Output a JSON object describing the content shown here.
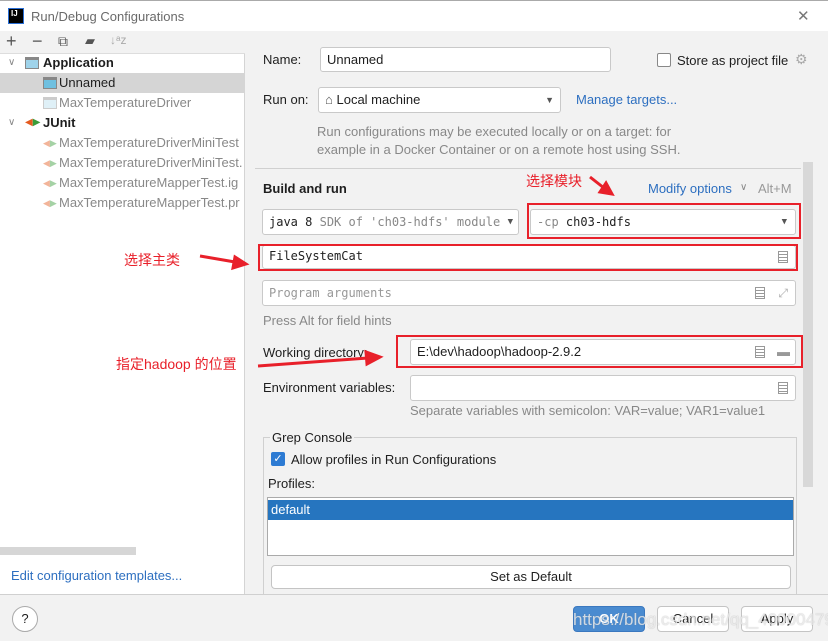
{
  "window": {
    "title": "Run/Debug Configurations",
    "close": "✕"
  },
  "toolbar": {
    "add": "+",
    "remove": "−",
    "copy": "⧉",
    "folder": "▰",
    "sort": "↓ᵃz"
  },
  "tree": [
    {
      "label": "Application",
      "type": "group",
      "expanded": true
    },
    {
      "label": "Unnamed",
      "type": "app",
      "selected": true
    },
    {
      "label": "MaxTemperatureDriver",
      "type": "app",
      "temporary": true
    },
    {
      "label": "JUnit",
      "type": "group",
      "expanded": true
    },
    {
      "label": "MaxTemperatureDriverMiniTest",
      "type": "junit",
      "temporary": true
    },
    {
      "label": "MaxTemperatureDriverMiniTest.",
      "type": "junit",
      "temporary": true
    },
    {
      "label": "MaxTemperatureMapperTest.ig",
      "type": "junit",
      "temporary": true
    },
    {
      "label": "MaxTemperatureMapperTest.pr",
      "type": "junit",
      "temporary": true
    }
  ],
  "edit_templates": "Edit configuration templates...",
  "form": {
    "name_label": "Name:",
    "name_value": "Unnamed",
    "store_label": "Store as project file",
    "store_checked": false,
    "run_on_label": "Run on:",
    "run_on_value": "Local machine",
    "manage_targets": "Manage targets...",
    "run_on_hint_1": "Run configurations may be executed locally or on a target: for",
    "run_on_hint_2": "example in a Docker Container or on a remote host using SSH.",
    "build_and_run": "Build and run",
    "modify_options": "Modify options",
    "modify_shortcut": "Alt+M",
    "jre_bold": "java 8",
    "jre_rest": "SDK of 'ch03-hdfs' module",
    "cp_prefix": "-cp",
    "cp_value": "ch03-hdfs",
    "main_class": "FileSystemCat",
    "program_args_placeholder": "Program arguments",
    "field_hints": "Press Alt for field hints",
    "workdir_label": "Working directory:",
    "workdir_value": "E:\\dev\\hadoop\\hadoop-2.9.2",
    "env_label": "Environment variables:",
    "env_value": "",
    "env_hint": "Separate variables with semicolon: VAR=value; VAR1=value1",
    "grep_title": "Grep Console",
    "allow_profiles": "Allow profiles in Run Configurations",
    "allow_checked": true,
    "profiles_label": "Profiles:",
    "profiles": [
      "default"
    ],
    "set_default": "Set as Default"
  },
  "annotations": {
    "module": "选择模块",
    "main_class": "选择主类",
    "hadoop": "指定hadoop 的位置"
  },
  "footer": {
    "help": "?",
    "ok": "OK",
    "cancel": "Cancel",
    "apply": "Apply"
  },
  "watermark": "https://blog.csdn.net/qq_40000479",
  "colors": {
    "accent": "#2675bf",
    "link": "#2d6fc0",
    "annotation": "#e8202a",
    "ok": "#4a8bd0"
  }
}
